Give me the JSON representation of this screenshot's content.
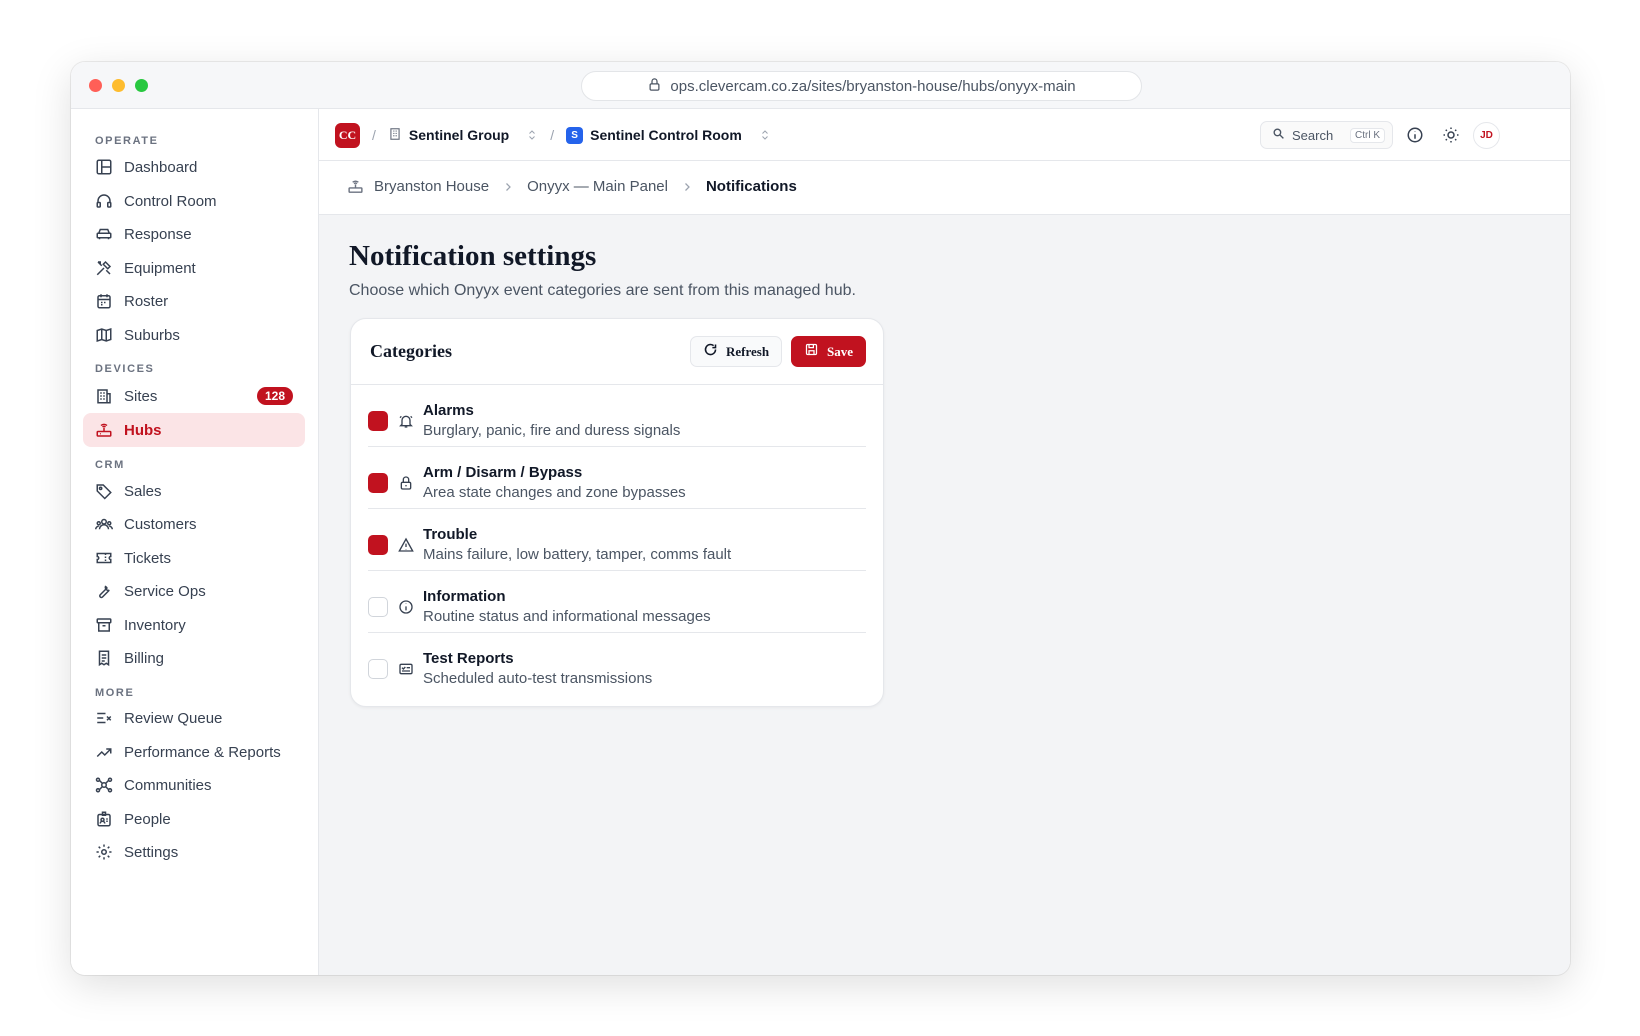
{
  "browser": {
    "url": "ops.clevercam.co.za/sites/bryanston-house/hubs/onyyx-main"
  },
  "sidebar": {
    "sections": [
      {
        "label": "OPERATE"
      },
      {
        "label": "DEVICES"
      },
      {
        "label": "CRM"
      },
      {
        "label": "MORE"
      }
    ],
    "items": [
      {
        "label": "Dashboard",
        "icon": "layout-icon"
      },
      {
        "label": "Control Room",
        "icon": "headset-icon"
      },
      {
        "label": "Response",
        "icon": "car-icon"
      },
      {
        "label": "Equipment",
        "icon": "tools-icon"
      },
      {
        "label": "Roster",
        "icon": "calendar-icon"
      },
      {
        "label": "Suburbs",
        "icon": "map-icon"
      },
      {
        "label": "Sites",
        "icon": "building-icon",
        "badge": "128"
      },
      {
        "label": "Hubs",
        "icon": "router-icon",
        "active": true
      },
      {
        "label": "Sales",
        "icon": "tag-icon"
      },
      {
        "label": "Customers",
        "icon": "users-icon"
      },
      {
        "label": "Tickets",
        "icon": "ticket-icon"
      },
      {
        "label": "Service Ops",
        "icon": "wrench-icon"
      },
      {
        "label": "Inventory",
        "icon": "archive-icon"
      },
      {
        "label": "Billing",
        "icon": "receipt-icon"
      },
      {
        "label": "Review Queue",
        "icon": "list-check-icon"
      },
      {
        "label": "Performance & Reports",
        "icon": "trend-icon"
      },
      {
        "label": "Communities",
        "icon": "network-icon"
      },
      {
        "label": "People",
        "icon": "id-badge-icon"
      },
      {
        "label": "Settings",
        "icon": "gear-icon"
      }
    ]
  },
  "topbar": {
    "logo": "CC",
    "org": "Sentinel Group",
    "workspace_initial": "S",
    "workspace": "Sentinel Control Room",
    "search_label": "Search",
    "search_shortcut": "Ctrl K",
    "avatar": "JD"
  },
  "breadcrumb": {
    "site": "Bryanston House",
    "hub": "Onyyx — Main Panel",
    "current": "Notifications"
  },
  "page": {
    "title": "Notification settings",
    "subtitle": "Choose which Onyyx event categories are sent from this managed hub."
  },
  "card": {
    "title": "Categories",
    "refresh_label": "Refresh",
    "save_label": "Save",
    "categories": [
      {
        "title": "Alarms",
        "desc": "Burglary, panic, fire and duress signals",
        "checked": true,
        "icon": "bell-icon"
      },
      {
        "title": "Arm / Disarm / Bypass",
        "desc": "Area state changes and zone bypasses",
        "checked": true,
        "icon": "lock-icon"
      },
      {
        "title": "Trouble",
        "desc": "Mains failure, low battery, tamper, comms fault",
        "checked": true,
        "icon": "warning-icon"
      },
      {
        "title": "Information",
        "desc": "Routine status and informational messages",
        "checked": false,
        "icon": "info-icon"
      },
      {
        "title": "Test Reports",
        "desc": "Scheduled auto-test transmissions",
        "checked": false,
        "icon": "test-report-icon"
      }
    ]
  },
  "colors": {
    "accent": "#c1121f",
    "workspace": "#2563eb"
  }
}
